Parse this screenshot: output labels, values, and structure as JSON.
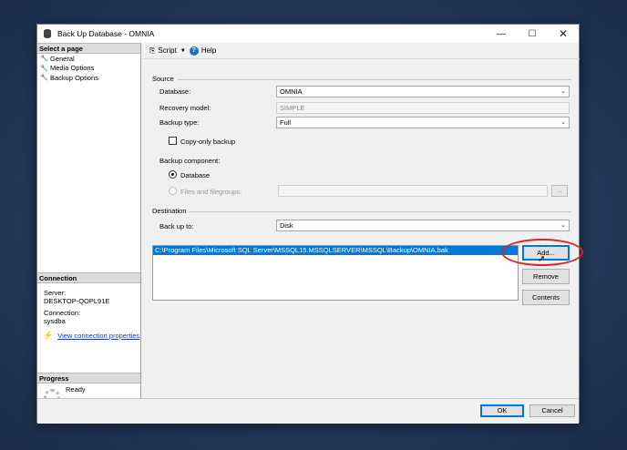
{
  "window": {
    "title": "Back Up Database - OMNIA",
    "minimize_glyph": "—",
    "maximize_glyph": "☐",
    "close_glyph": "✕"
  },
  "sidebar": {
    "select_page_header": "Select a page",
    "pages": [
      {
        "label": "General",
        "icon": "wrench-icon"
      },
      {
        "label": "Media Options",
        "icon": "wrench-icon"
      },
      {
        "label": "Backup Options",
        "icon": "wrench-icon"
      }
    ],
    "connection_header": "Connection",
    "server_label": "Server:",
    "server_value": "DESKTOP-QOPL91E",
    "connection_label": "Connection:",
    "connection_value": "sysdba",
    "view_props_link": "View connection properties",
    "progress_header": "Progress",
    "progress_status": "Ready"
  },
  "toolbar": {
    "script_label": "Script",
    "help_label": "Help"
  },
  "source": {
    "group_label": "Source",
    "database_label": "Database:",
    "database_value": "OMNIA",
    "recovery_label": "Recovery model:",
    "recovery_value": "SIMPLE",
    "backup_type_label": "Backup type:",
    "backup_type_value": "Full",
    "copy_only_label": "Copy-only backup",
    "copy_only_checked": false,
    "component_label": "Backup component:",
    "component_database": "Database",
    "component_files": "Files and filegroups:",
    "browse_label": "..."
  },
  "destination": {
    "group_label": "Destination",
    "backup_to_label": "Back up to:",
    "backup_to_value": "Disk",
    "paths": [
      "C:\\Program Files\\Microsoft SQL Server\\MSSQL15.MSSQLSERVER\\MSSQL\\Backup\\OMNIA.bak"
    ],
    "add_label": "Add...",
    "remove_label": "Remove",
    "contents_label": "Contents"
  },
  "footer": {
    "ok_label": "OK",
    "cancel_label": "Cancel"
  },
  "colors": {
    "selection": "#0078d7",
    "highlight": "#d62828",
    "link": "#1a3db5"
  }
}
